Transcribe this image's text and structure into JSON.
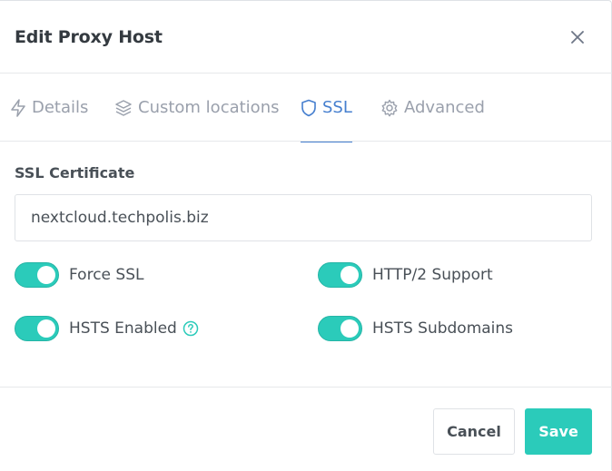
{
  "modal": {
    "title": "Edit Proxy Host",
    "close_icon": "close-icon"
  },
  "tabs": [
    {
      "label": "Details",
      "icon": "bolt-icon",
      "active": false
    },
    {
      "label": "Custom locations",
      "icon": "layers-icon",
      "active": false
    },
    {
      "label": "SSL",
      "icon": "shield-icon",
      "active": true
    },
    {
      "label": "Advanced",
      "icon": "gear-icon",
      "active": false
    }
  ],
  "ssl": {
    "certificate_label": "SSL Certificate",
    "certificate_value": "nextcloud.techpolis.biz",
    "toggles": [
      {
        "label": "Force SSL",
        "on": true
      },
      {
        "label": "HTTP/2 Support",
        "on": true
      },
      {
        "label": "HSTS Enabled",
        "on": true,
        "help_icon": "help-circle-icon"
      },
      {
        "label": "HSTS Subdomains",
        "on": true
      }
    ]
  },
  "footer": {
    "cancel_label": "Cancel",
    "save_label": "Save"
  },
  "colors": {
    "accent": "#2bcbba",
    "active_tab": "#467fcf"
  }
}
